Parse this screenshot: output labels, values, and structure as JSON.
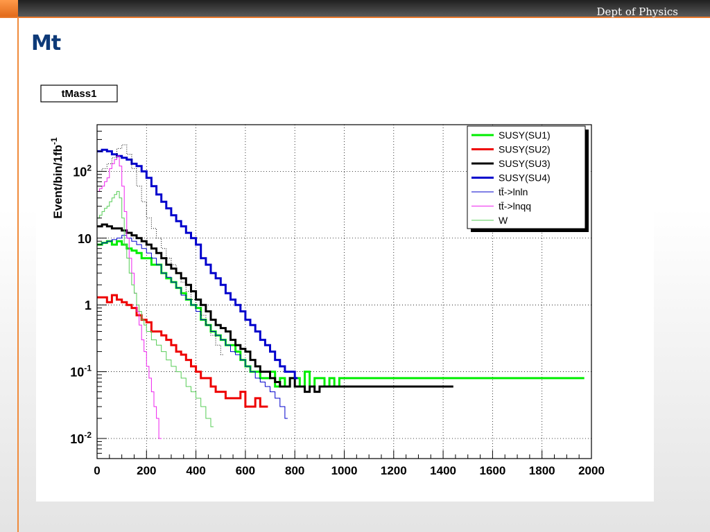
{
  "header": {
    "dept_label": "Dept of Physics",
    "accent_color": "#e8782c"
  },
  "slide": {
    "title": "Mt",
    "title_color": "#0e3a78"
  },
  "chart_data": {
    "type": "line",
    "title": "tMass1",
    "xlabel": "",
    "ylabel": "Event/bin/1fb",
    "ylabel_superscript": "-1",
    "y_scale": "log",
    "xlim": [
      0,
      2000
    ],
    "ylim": [
      0.005,
      500
    ],
    "grid": true,
    "legend_position": "top-right",
    "x_ticks": [
      0,
      200,
      400,
      600,
      800,
      1000,
      1200,
      1400,
      1600,
      1800,
      2000
    ],
    "x_tick_labels": [
      "0",
      "200",
      "400",
      "600",
      "800",
      "1000",
      "1200",
      "1400",
      "1600",
      "1800",
      "2000"
    ],
    "y_ticks": [
      0.01,
      0.1,
      1,
      10,
      100
    ],
    "y_tick_labels": [
      {
        "base": "10",
        "exp": "-2"
      },
      {
        "base": "10",
        "exp": "-1"
      },
      {
        "base": "1",
        "exp": ""
      },
      {
        "base": "10",
        "exp": ""
      },
      {
        "base": "10",
        "exp": "2"
      }
    ],
    "series": [
      {
        "name": "SUSY(SU1)",
        "color": "#00ee00",
        "width": 3,
        "x": [
          0,
          20,
          40,
          60,
          80,
          100,
          120,
          140,
          160,
          180,
          200,
          220,
          240,
          260,
          280,
          300,
          320,
          340,
          360,
          380,
          400,
          420,
          440,
          460,
          480,
          500,
          520,
          540,
          560,
          580,
          600,
          620,
          640,
          660,
          680,
          700,
          720,
          740,
          760,
          780,
          800,
          820,
          840,
          860,
          880,
          900,
          920,
          940,
          960,
          980,
          1960
        ],
        "y": [
          8,
          8.5,
          9,
          8,
          9,
          8,
          7,
          6.5,
          6,
          5,
          5,
          4,
          4,
          3,
          2.5,
          2.2,
          1.8,
          1.5,
          1.2,
          1,
          0.9,
          0.6,
          0.5,
          0.4,
          0.35,
          0.3,
          0.25,
          0.25,
          0.2,
          0.15,
          0.12,
          0.1,
          0.1,
          0.08,
          0.08,
          0.1,
          0.06,
          0.08,
          0.06,
          0.08,
          0.08,
          0.06,
          0.1,
          0.06,
          0.08,
          0.08,
          0.06,
          0.08,
          0.06,
          0.08,
          0.08
        ]
      },
      {
        "name": "SUSY(SU2)",
        "color": "#ee0000",
        "width": 3,
        "x": [
          0,
          20,
          40,
          60,
          80,
          100,
          120,
          140,
          160,
          180,
          200,
          220,
          240,
          260,
          280,
          300,
          320,
          340,
          360,
          380,
          400,
          420,
          440,
          460,
          480,
          500,
          520,
          540,
          560,
          580,
          600,
          620,
          640,
          660,
          680
        ],
        "y": [
          1.3,
          1.3,
          1.1,
          1.4,
          1.2,
          1.1,
          1,
          0.9,
          0.7,
          0.6,
          0.55,
          0.4,
          0.4,
          0.35,
          0.3,
          0.25,
          0.2,
          0.18,
          0.15,
          0.12,
          0.1,
          0.08,
          0.08,
          0.06,
          0.05,
          0.05,
          0.04,
          0.04,
          0.04,
          0.05,
          0.03,
          0.03,
          0.04,
          0.03,
          0.03
        ]
      },
      {
        "name": "SUSY(SU3)",
        "color": "#000000",
        "width": 3,
        "x": [
          0,
          20,
          40,
          60,
          80,
          100,
          120,
          140,
          160,
          180,
          200,
          220,
          240,
          260,
          280,
          300,
          320,
          340,
          360,
          380,
          400,
          420,
          440,
          460,
          480,
          500,
          520,
          540,
          560,
          580,
          600,
          620,
          640,
          660,
          680,
          700,
          720,
          740,
          760,
          780,
          800,
          820,
          840,
          860,
          880,
          900,
          1100,
          1430
        ],
        "y": [
          15,
          16,
          15,
          14,
          14,
          13,
          12,
          11,
          10,
          9,
          8,
          7,
          6,
          5,
          4,
          3.5,
          3,
          2.5,
          2,
          1.6,
          1.2,
          1,
          0.8,
          0.6,
          0.5,
          0.45,
          0.4,
          0.3,
          0.25,
          0.22,
          0.2,
          0.15,
          0.12,
          0.1,
          0.1,
          0.08,
          0.07,
          0.06,
          0.06,
          0.08,
          0.06,
          0.06,
          0.05,
          0.06,
          0.05,
          0.06,
          0.06,
          0.06
        ]
      },
      {
        "name": "SUSY(SU4)",
        "color": "#0000cc",
        "width": 3,
        "x": [
          0,
          20,
          40,
          60,
          80,
          100,
          120,
          140,
          160,
          180,
          200,
          220,
          240,
          260,
          280,
          300,
          320,
          340,
          360,
          380,
          400,
          420,
          440,
          460,
          480,
          500,
          520,
          540,
          560,
          580,
          600,
          620,
          640,
          660,
          680,
          700,
          720,
          740,
          760,
          780,
          800
        ],
        "y": [
          200,
          210,
          200,
          180,
          170,
          160,
          150,
          130,
          120,
          100,
          80,
          60,
          45,
          35,
          28,
          22,
          18,
          15,
          12,
          10,
          8,
          5,
          4,
          3,
          2.5,
          2,
          1.5,
          1.2,
          1,
          0.8,
          0.6,
          0.5,
          0.4,
          0.3,
          0.25,
          0.2,
          0.15,
          0.12,
          0.1,
          0.1,
          0.08
        ]
      },
      {
        "name": "tt̄->lnln",
        "color": "#0000cc",
        "width": 1,
        "x": [
          0,
          20,
          40,
          60,
          80,
          100,
          120,
          140,
          160,
          180,
          200,
          220,
          240,
          260,
          280,
          300,
          320,
          340,
          360,
          380,
          400,
          420,
          440,
          460,
          480,
          500,
          520,
          540,
          560,
          580,
          600,
          620,
          640,
          660,
          680,
          700,
          720,
          740,
          760
        ],
        "y": [
          8,
          8.5,
          9,
          9.5,
          10,
          11,
          10,
          9,
          8,
          7,
          6,
          5,
          4,
          3,
          2.6,
          2.2,
          1.8,
          1.4,
          1.2,
          1,
          0.8,
          0.6,
          0.5,
          0.4,
          0.35,
          0.3,
          0.25,
          0.2,
          0.18,
          0.15,
          0.12,
          0.1,
          0.08,
          0.07,
          0.06,
          0.05,
          0.04,
          0.03,
          0.02
        ]
      },
      {
        "name": "tt̄->lnqq",
        "color": "#ee22ee",
        "width": 1,
        "x": [
          0,
          10,
          20,
          30,
          40,
          50,
          60,
          70,
          80,
          90,
          100,
          110,
          120,
          130,
          140,
          150,
          160,
          170,
          180,
          190,
          200,
          210,
          220,
          230,
          240,
          250
        ],
        "y": [
          50,
          55,
          60,
          70,
          80,
          110,
          130,
          150,
          170,
          120,
          60,
          25,
          10,
          5,
          3,
          1.5,
          0.8,
          0.5,
          0.3,
          0.2,
          0.12,
          0.08,
          0.05,
          0.03,
          0.02,
          0.01
        ]
      },
      {
        "name": "W",
        "color": "#55cc55",
        "width": 1,
        "x": [
          0,
          10,
          20,
          30,
          40,
          50,
          60,
          70,
          80,
          90,
          100,
          110,
          120,
          130,
          140,
          150,
          160,
          170,
          180,
          190,
          200,
          220,
          240,
          260,
          280,
          300,
          320,
          340,
          360,
          380,
          400,
          420,
          440,
          460
        ],
        "y": [
          20,
          22,
          25,
          28,
          30,
          35,
          40,
          45,
          50,
          40,
          20,
          8,
          5,
          3,
          2,
          1.5,
          1,
          0.8,
          0.6,
          0.5,
          0.4,
          0.3,
          0.25,
          0.2,
          0.15,
          0.12,
          0.1,
          0.08,
          0.06,
          0.05,
          0.04,
          0.03,
          0.02,
          0.015
        ]
      },
      {
        "name": "",
        "color": "#000000",
        "width": 1,
        "dotted": true,
        "x": [
          0,
          20,
          40,
          60,
          80,
          100,
          120,
          140,
          160,
          180,
          200,
          220,
          240,
          260,
          280,
          300,
          320,
          340,
          360,
          380,
          400,
          420,
          440,
          460,
          480,
          500
        ],
        "y": [
          100,
          110,
          130,
          160,
          220,
          250,
          180,
          110,
          60,
          35,
          20,
          14,
          10,
          7,
          5,
          4,
          3,
          2.2,
          1.6,
          1.2,
          1,
          0.7,
          0.5,
          0.35,
          0.25,
          0.18
        ]
      }
    ]
  }
}
